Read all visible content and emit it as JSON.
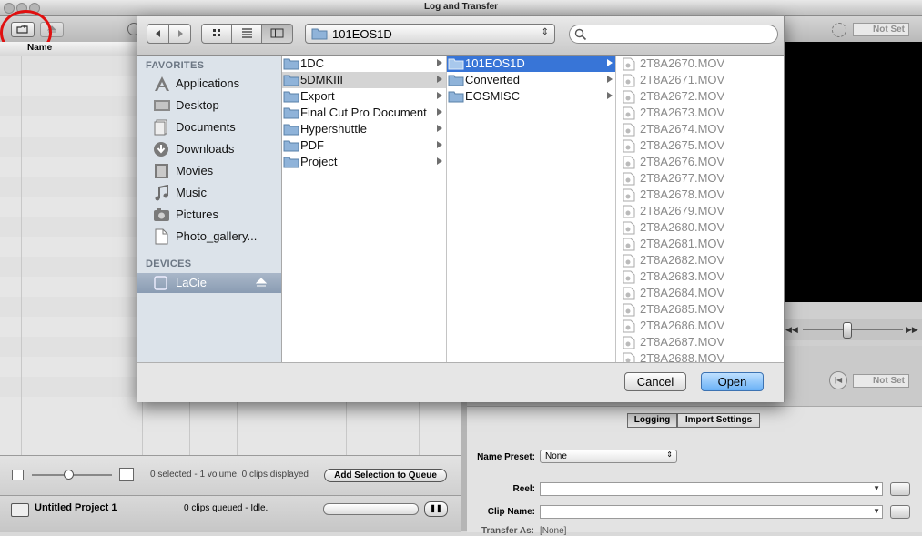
{
  "window": {
    "title": "Log and Transfer"
  },
  "browser": {
    "column_header": "Name",
    "status": "0 selected - 1 volume, 0 clips displayed",
    "add_button": "Add Selection to Queue",
    "project": "Untitled Project 1",
    "queue_status": "0 clips queued - Idle."
  },
  "viewer": {
    "timecode_top": "Not Set",
    "timecode_bottom": "Not Set"
  },
  "logging": {
    "tabs": [
      "Logging",
      "Import Settings"
    ],
    "name_preset_label": "Name Preset:",
    "name_preset_value": "None",
    "reel_label": "Reel:",
    "clip_name_label": "Clip Name:",
    "transfer_as_label": "Transfer As:",
    "transfer_as_value": "[None]"
  },
  "dialog": {
    "path": "101EOS1D",
    "search_placeholder": "",
    "sidebar": {
      "favorites_header": "FAVORITES",
      "favorites": [
        {
          "label": "Applications",
          "icon": "applications-icon"
        },
        {
          "label": "Desktop",
          "icon": "desktop-icon"
        },
        {
          "label": "Documents",
          "icon": "documents-icon"
        },
        {
          "label": "Downloads",
          "icon": "downloads-icon"
        },
        {
          "label": "Movies",
          "icon": "movies-icon"
        },
        {
          "label": "Music",
          "icon": "music-icon"
        },
        {
          "label": "Pictures",
          "icon": "pictures-icon"
        },
        {
          "label": "Photo_gallery...",
          "icon": "file-icon"
        }
      ],
      "devices_header": "DEVICES",
      "devices": [
        {
          "label": "LaCie",
          "icon": "drive-icon"
        }
      ]
    },
    "column1": [
      "1DC",
      "5DMKIII",
      "Export",
      "Final Cut Pro Document",
      "Hypershuttle",
      "PDF",
      "Project"
    ],
    "column2": [
      "101EOS1D",
      "Converted",
      "EOSMISC"
    ],
    "column3": [
      "2T8A2670.MOV",
      "2T8A2671.MOV",
      "2T8A2672.MOV",
      "2T8A2673.MOV",
      "2T8A2674.MOV",
      "2T8A2675.MOV",
      "2T8A2676.MOV",
      "2T8A2677.MOV",
      "2T8A2678.MOV",
      "2T8A2679.MOV",
      "2T8A2680.MOV",
      "2T8A2681.MOV",
      "2T8A2682.MOV",
      "2T8A2683.MOV",
      "2T8A2684.MOV",
      "2T8A2685.MOV",
      "2T8A2686.MOV",
      "2T8A2687.MOV",
      "2T8A2688.MOV"
    ],
    "cancel": "Cancel",
    "open": "Open"
  },
  "colors": {
    "selection": "#3875d7",
    "annotation": "#e01010"
  }
}
